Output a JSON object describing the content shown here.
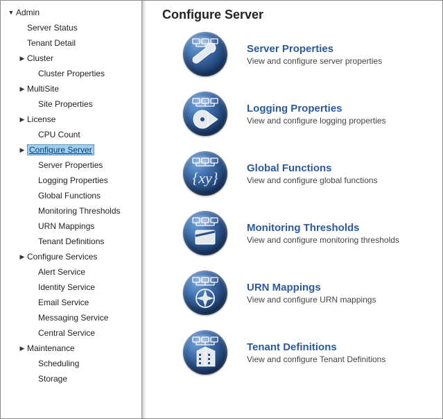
{
  "sidebar": {
    "items": [
      {
        "label": "Admin",
        "level": 1,
        "caret": "down",
        "interactable": true
      },
      {
        "label": "Server Status",
        "level": 2,
        "caret": "none",
        "interactable": true
      },
      {
        "label": "Tenant Detail",
        "level": 2,
        "caret": "none",
        "interactable": true
      },
      {
        "label": "Cluster",
        "level": 2,
        "caret": "right",
        "interactable": true
      },
      {
        "label": "Cluster Properties",
        "level": 3,
        "caret": "none",
        "interactable": true
      },
      {
        "label": "MultiSite",
        "level": 2,
        "caret": "right",
        "interactable": true
      },
      {
        "label": "Site Properties",
        "level": 3,
        "caret": "none",
        "interactable": true
      },
      {
        "label": "License",
        "level": 2,
        "caret": "right",
        "interactable": true
      },
      {
        "label": "CPU Count",
        "level": 3,
        "caret": "none",
        "interactable": true
      },
      {
        "label": "Configure Server",
        "level": 2,
        "caret": "right",
        "interactable": true,
        "current": true
      },
      {
        "label": "Server Properties",
        "level": 3,
        "caret": "none",
        "interactable": true
      },
      {
        "label": "Logging Properties",
        "level": 3,
        "caret": "none",
        "interactable": true
      },
      {
        "label": "Global Functions",
        "level": 3,
        "caret": "none",
        "interactable": true
      },
      {
        "label": "Monitoring Thresholds",
        "level": 3,
        "caret": "none",
        "interactable": true
      },
      {
        "label": "URN Mappings",
        "level": 3,
        "caret": "none",
        "interactable": true
      },
      {
        "label": "Tenant Definitions",
        "level": 3,
        "caret": "none",
        "interactable": true
      },
      {
        "label": "Configure Services",
        "level": 2,
        "caret": "right",
        "interactable": true
      },
      {
        "label": "Alert Service",
        "level": 3,
        "caret": "none",
        "interactable": true
      },
      {
        "label": "Identity Service",
        "level": 3,
        "caret": "none",
        "interactable": true
      },
      {
        "label": "Email Service",
        "level": 3,
        "caret": "none",
        "interactable": true
      },
      {
        "label": "Messaging Service",
        "level": 3,
        "caret": "none",
        "interactable": true
      },
      {
        "label": "Central Service",
        "level": 3,
        "caret": "none",
        "interactable": true
      },
      {
        "label": "Maintenance",
        "level": 2,
        "caret": "right",
        "interactable": true
      },
      {
        "label": "Scheduling",
        "level": 3,
        "caret": "none",
        "interactable": true
      },
      {
        "label": "Storage",
        "level": 3,
        "caret": "none",
        "interactable": true
      }
    ]
  },
  "main": {
    "title": "Configure Server",
    "cards": [
      {
        "icon": "wrench",
        "title": "Server Properties",
        "desc": "View and configure server properties"
      },
      {
        "icon": "disc",
        "title": "Logging Properties",
        "desc": "View and configure logging properties"
      },
      {
        "icon": "fx",
        "title": "Global Functions",
        "desc": "View and configure global functions"
      },
      {
        "icon": "monitor",
        "title": "Monitoring Thresholds",
        "desc": "View and configure monitoring thresholds"
      },
      {
        "icon": "compass",
        "title": "URN Mappings",
        "desc": "View and configure URN mappings"
      },
      {
        "icon": "building",
        "title": "Tenant Definitions",
        "desc": "View and configure Tenant Definitions"
      }
    ]
  }
}
